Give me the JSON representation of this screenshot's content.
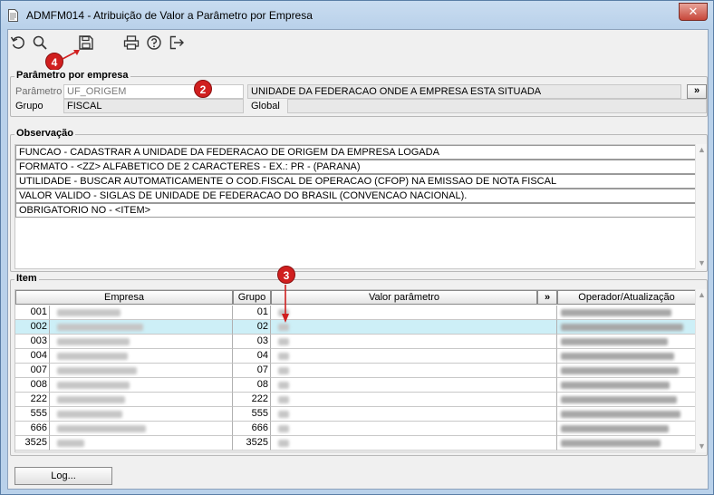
{
  "window": {
    "title": "ADMFM014 - Atribuição de Valor a Parâmetro por Empresa",
    "close_label": "✕"
  },
  "toolbar": {
    "buttons": [
      {
        "name": "undo-icon"
      },
      {
        "name": "search-icon"
      },
      {
        "name": "save-icon"
      },
      {
        "name": "print-icon"
      },
      {
        "name": "help-icon"
      },
      {
        "name": "exit-icon"
      }
    ]
  },
  "badges": {
    "b2": "2",
    "b3": "3",
    "b4": "4"
  },
  "param_group": {
    "legend": "Parâmetro por empresa",
    "parametro_label": "Parâmetro",
    "parametro_value": "UF_ORIGEM",
    "parametro_desc": "UNIDADE DA FEDERACAO ONDE A EMPRESA  ESTA SITUADA",
    "more_label": "»",
    "grupo_label": "Grupo",
    "grupo_value": "FISCAL",
    "global_label": "Global",
    "global_value": ""
  },
  "observacao": {
    "legend": "Observação",
    "lines": [
      "FUNCAO - CADASTRAR A UNIDADE DA FEDERACAO DE ORIGEM DA EMPRESA LOGADA",
      "FORMATO -  <ZZ> ALFABETICO DE 2 CARACTERES - EX.: PR - (PARANA)",
      "UTILIDADE -  BUSCAR AUTOMATICAMENTE O COD.FISCAL DE OPERACAO (CFOP)  NA EMISSAO DE NOTA FISCAL",
      "VALOR VALIDO - SIGLAS DE UNIDADE DE FEDERACAO DO BRASIL (CONVENCAO NACIONAL).",
      "OBRIGATORIO NO - <ITEM>"
    ]
  },
  "item": {
    "legend": "Item",
    "headers": {
      "empresa": "Empresa",
      "grupo": "Grupo",
      "valor": "Valor parâmetro",
      "more": "»",
      "operador": "Operador/Atualização"
    },
    "rows": [
      {
        "code": "001",
        "grupo": "01",
        "selected": false
      },
      {
        "code": "002",
        "grupo": "02",
        "selected": true
      },
      {
        "code": "003",
        "grupo": "03",
        "selected": false
      },
      {
        "code": "004",
        "grupo": "04",
        "selected": false
      },
      {
        "code": "007",
        "grupo": "07",
        "selected": false
      },
      {
        "code": "008",
        "grupo": "08",
        "selected": false
      },
      {
        "code": "222",
        "grupo": "222",
        "selected": false
      },
      {
        "code": "555",
        "grupo": "555",
        "selected": false
      },
      {
        "code": "666",
        "grupo": "666",
        "selected": false
      },
      {
        "code": "3525",
        "grupo": "3525",
        "selected": false
      }
    ]
  },
  "log_button": "Log...",
  "colors": {
    "selected_row": "#cdeff7",
    "badge": "#d01f1f",
    "arrow": "#d01f1f"
  }
}
